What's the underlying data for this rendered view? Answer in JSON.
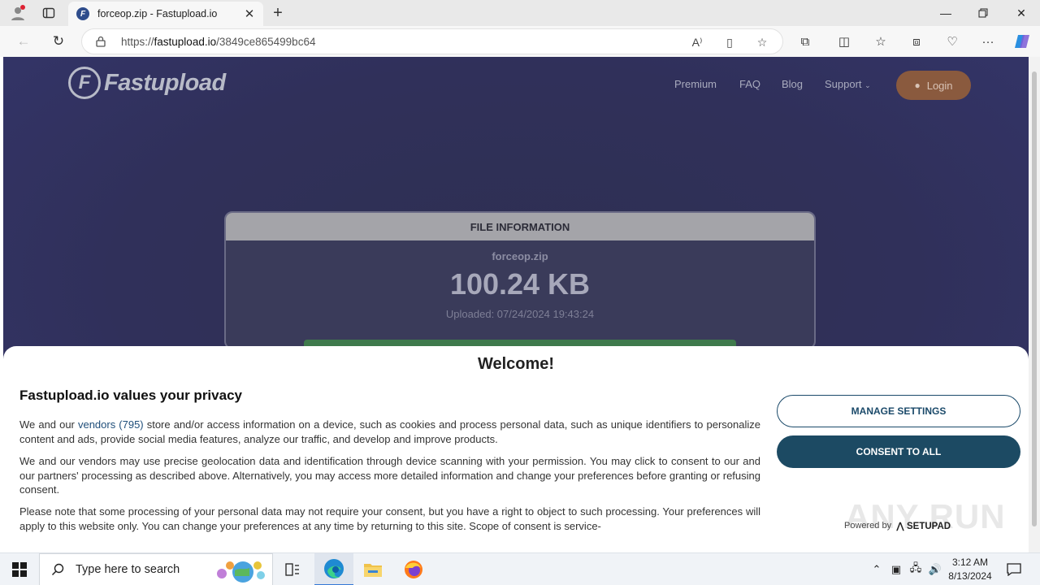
{
  "browser": {
    "tab_title": "forceop.zip - Fastupload.io",
    "url_prefix": "https://",
    "url_domain": "fastupload.io",
    "url_path": "/3849ce865499bc64"
  },
  "site": {
    "logo_text": "Fastupload",
    "nav": [
      "Premium",
      "FAQ",
      "Blog",
      "Support"
    ],
    "login_label": "Login"
  },
  "file_info": {
    "header": "FILE INFORMATION",
    "file_name": "forceop.zip",
    "file_size": "100.24 KB",
    "uploaded": "Uploaded: 07/24/2024 19:43:24"
  },
  "consent": {
    "welcome": "Welcome!",
    "title": "Fastupload.io values your privacy",
    "p1_before": "We and our ",
    "p1_link": "vendors (795)",
    "p1_after": " store and/or access information on a device, such as cookies and process personal data, such as unique identifiers to personalize content and ads, provide social media features, analyze our traffic, and develop and improve products.",
    "p2": "We and our vendors may use precise geolocation data and identification through device scanning with your permission. You may click to consent to our and our partners' processing as described above. Alternatively, you may access more detailed information and change your preferences before granting or refusing consent.",
    "p3": "Please note that some processing of your personal data may not require your consent, but you have a right to object to such processing. Your preferences will apply to this website only. You can change your preferences at any time by returning to this site. Scope of consent is service-",
    "manage_label": "MANAGE SETTINGS",
    "consent_label": "CONSENT TO ALL",
    "powered_by": "Powered by",
    "powered_brand": "SETUPAD",
    "watermark": "ANY RUN"
  },
  "taskbar": {
    "search_placeholder": "Type here to search",
    "time": "3:12 AM",
    "date": "8/13/2024"
  },
  "colors": {
    "page_bg": "#30305a",
    "login_btn": "#8a5a3e",
    "consent_btn": "#1c4a63",
    "link": "#1f4e7a",
    "progress": "#3f7a4c"
  }
}
